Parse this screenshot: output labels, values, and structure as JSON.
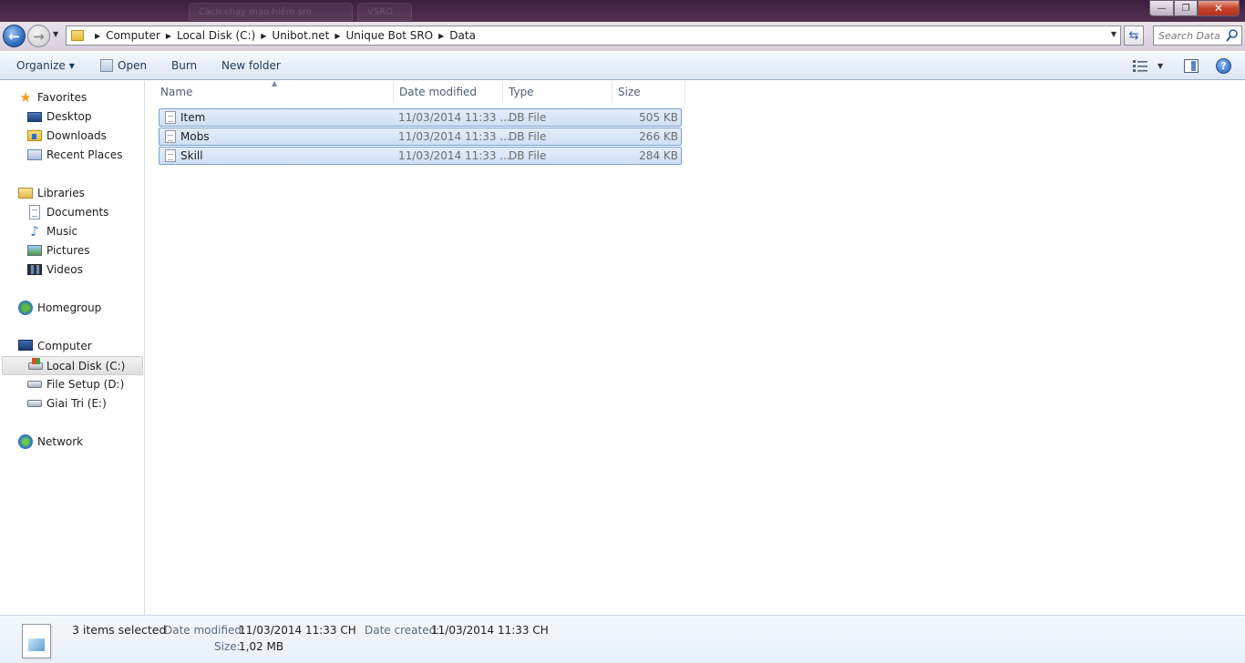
{
  "window": {
    "ghost_tabs": [
      "Cách chạy mạo hiểm sro",
      "VSRO"
    ],
    "controls": {
      "minimize": "—",
      "maximize": "❐",
      "close": "✕"
    }
  },
  "address_bar": {
    "breadcrumbs": [
      "Computer",
      "Local Disk (C:)",
      "Unibot.net",
      "Unique Bot SRO",
      "Data"
    ],
    "search_placeholder": "Search Data"
  },
  "toolbar": {
    "organize": "Organize",
    "open": "Open",
    "burn": "Burn",
    "new_folder": "New folder",
    "help": "?"
  },
  "nav": {
    "favorites": "Favorites",
    "favorites_items": [
      "Desktop",
      "Downloads",
      "Recent Places"
    ],
    "libraries": "Libraries",
    "libraries_items": [
      "Documents",
      "Music",
      "Pictures",
      "Videos"
    ],
    "homegroup": "Homegroup",
    "computer": "Computer",
    "computer_items": [
      "Local Disk (C:)",
      "File Setup (D:)",
      "Giai Tri (E:)"
    ],
    "network": "Network",
    "selected": "Local Disk (C:)"
  },
  "columns": {
    "name": "Name",
    "date_modified": "Date modified",
    "type": "Type",
    "size": "Size"
  },
  "files": [
    {
      "name": "Item",
      "date": "11/03/2014 11:33 ...",
      "type": "DB File",
      "size": "505 KB",
      "selected": true
    },
    {
      "name": "Mobs",
      "date": "11/03/2014 11:33 ...",
      "type": "DB File",
      "size": "266 KB",
      "selected": true
    },
    {
      "name": "Skill",
      "date": "11/03/2014 11:33 ...",
      "type": "DB File",
      "size": "284 KB",
      "selected": true
    }
  ],
  "details": {
    "count": "3 items selected",
    "date_modified_label": "Date modified:",
    "date_modified": "11/03/2014 11:33 CH",
    "date_created_label": "Date created:",
    "date_created": "11/03/2014 11:33 CH",
    "size_label": "Size:",
    "size": "1,02 MB"
  },
  "colors": {
    "accent": "#1e395b",
    "selection": "#cfe0f5",
    "title_bar": "#4a2a4c"
  }
}
